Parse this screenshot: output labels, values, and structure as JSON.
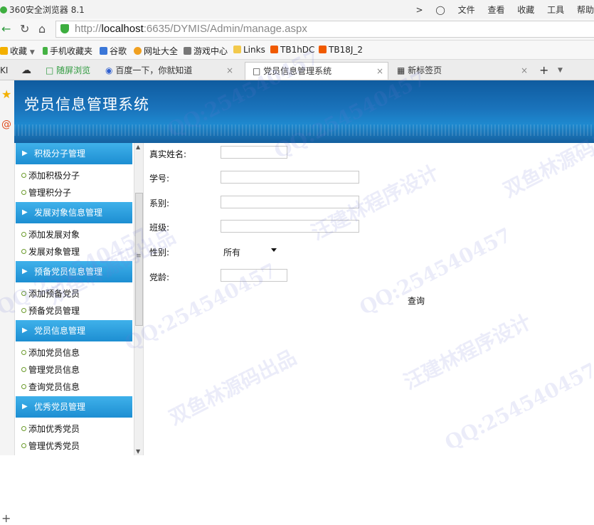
{
  "browser": {
    "app_title": "360安全浏览器 8.1",
    "menu": [
      "文件",
      "查看",
      "收藏",
      "工具",
      "帮助"
    ],
    "url_prefix": "http://",
    "url_host": "localhost",
    "url_rest": ":6635/DYMIS/Admin/manage.aspx",
    "favorites": [
      "收藏",
      "手机收藏夹",
      "谷歌",
      "网址大全",
      "游戏中心",
      "Links",
      "TB1hDC",
      "TB18J_2"
    ],
    "tabs": [
      "随屏浏览",
      "百度一下，你就知道",
      "党员信息管理系统",
      "新标签页"
    ],
    "left_mark": "KI"
  },
  "app": {
    "title": "党员信息管理系统"
  },
  "sidebar": {
    "sections": [
      {
        "title": "积极分子管理",
        "items": [
          "添加积极分子",
          "管理积分子"
        ]
      },
      {
        "title": "发展对象信息管理",
        "items": [
          "添加发展对象",
          "发展对象管理"
        ]
      },
      {
        "title": "预备党员信息管理",
        "items": [
          "添加预备党员",
          "预备党员管理"
        ]
      },
      {
        "title": "党员信息管理",
        "items": [
          "添加党员信息",
          "管理党员信息",
          "查询党员信息"
        ]
      },
      {
        "title": "优秀党员管理",
        "items": [
          "添加优秀党员",
          "管理优秀党员"
        ]
      }
    ]
  },
  "form": {
    "real_name_label": "真实姓名:",
    "student_id_label": "学号:",
    "department_label": "系别:",
    "class_label": "班级:",
    "gender_label": "性别:",
    "gender_value": "所有",
    "party_age_label": "党龄:",
    "query_label": "查询"
  },
  "watermarks": {
    "qq": "QQ:254540457",
    "author": "汪建林程序设计",
    "source": "双鱼林源码出品"
  },
  "colors": {
    "banner": "#1a73bb",
    "section_header": "#2a9fe0"
  }
}
